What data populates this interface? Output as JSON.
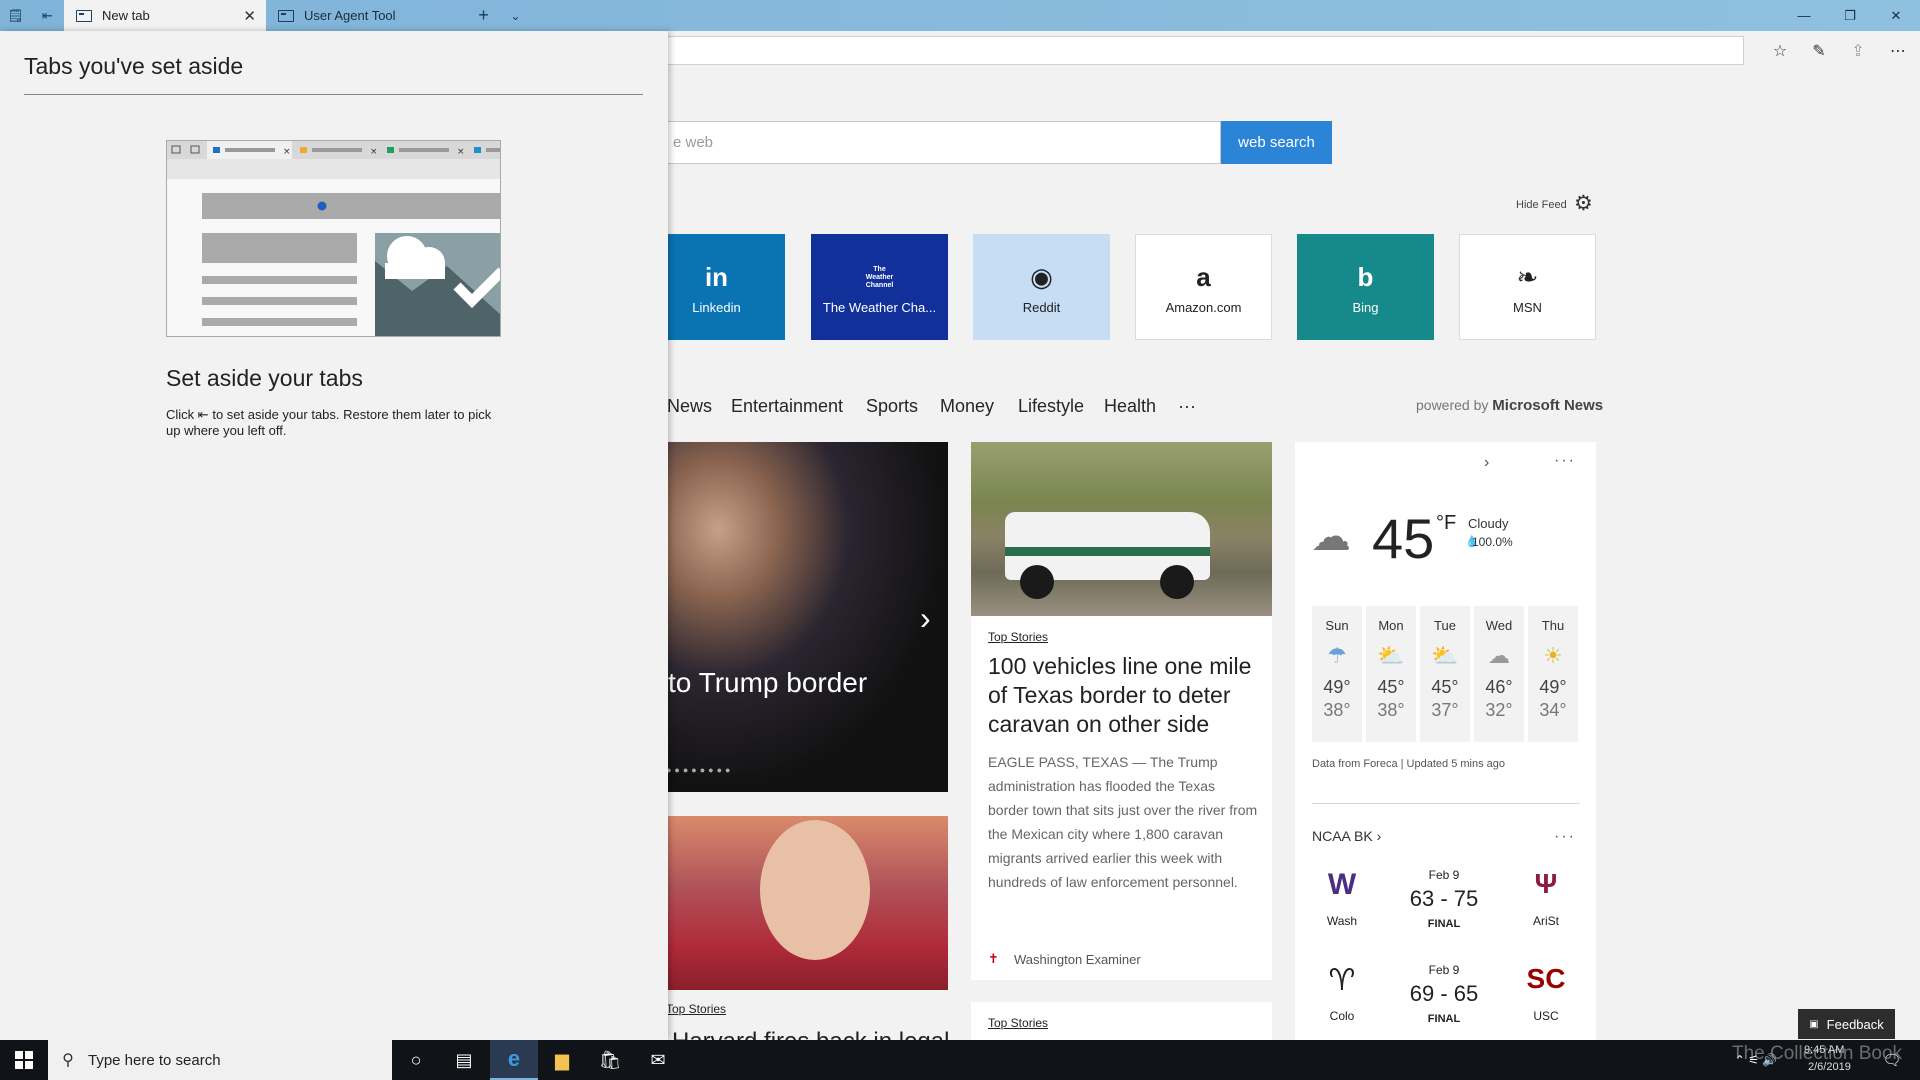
{
  "tabs": [
    {
      "label": "New tab"
    },
    {
      "label": "User Agent Tool"
    }
  ],
  "newtab": {
    "search_placeholder": "e web",
    "search_button": "web search",
    "hide_feed": "Hide Feed"
  },
  "tiles": [
    {
      "label": "Linkedin",
      "glyph": "in",
      "bg": "#0a73b1",
      "fg": "#ffffff"
    },
    {
      "label": "The Weather Cha...",
      "glyph": "The Weather Channel",
      "bg": "#12309a",
      "fg": "#ffffff"
    },
    {
      "label": "Reddit",
      "glyph": "◉",
      "bg": "#c6ddf4",
      "fg": "#222222"
    },
    {
      "label": "Amazon.com",
      "glyph": "a",
      "bg": "#ffffff",
      "fg": "#222222"
    },
    {
      "label": "Bing",
      "glyph": "b",
      "bg": "#168a8a",
      "fg": "#ffffff"
    },
    {
      "label": "MSN",
      "glyph": "❧",
      "bg": "#ffffff",
      "fg": "#222222"
    }
  ],
  "news_nav": [
    "News",
    "Entertainment",
    "Sports",
    "Money",
    "Lifestyle",
    "Health",
    "···"
  ],
  "powered_prefix": "powered by",
  "powered_brand": "Microsoft News",
  "hero": {
    "title": "to Trump border",
    "dots": "●●●●●●●●"
  },
  "card2": {
    "tag": "Top Stories",
    "title": "Harvard fires back in legal"
  },
  "card_mid": {
    "tag": "Top Stories",
    "title": "100 vehicles line one mile of Texas border to deter caravan on other side",
    "body": "EAGLE PASS, TEXAS — The Trump administration has flooded the Texas border town that sits just over the river from the Mexican city where 1,800 caravan migrants arrived earlier this week with hundreds of law enforcement personnel.",
    "source": "Washington Examiner"
  },
  "card_mid2": {
    "tag": "Top Stories"
  },
  "weather": {
    "temp": "45",
    "unit": "°F",
    "condition": "Cloudy",
    "precip": "100.0%",
    "days": [
      {
        "name": "Sun",
        "icon": "☂",
        "hi": "49°",
        "lo": "38°"
      },
      {
        "name": "Mon",
        "icon": "⛅",
        "hi": "45°",
        "lo": "38°"
      },
      {
        "name": "Tue",
        "icon": "⛅",
        "hi": "45°",
        "lo": "37°"
      },
      {
        "name": "Wed",
        "icon": "☁",
        "hi": "46°",
        "lo": "32°"
      },
      {
        "name": "Thu",
        "icon": "☀",
        "hi": "49°",
        "lo": "34°"
      }
    ],
    "source": "Data from Foreca | Updated 5 mins ago"
  },
  "ncaa": {
    "title": "NCAA BK",
    "games": [
      {
        "home": "Wash",
        "home_logo": "W",
        "away": "AriSt",
        "away_logo": "Ψ",
        "date": "Feb 9",
        "score": "63 - 75",
        "status": "FINAL"
      },
      {
        "home": "Colo",
        "home_logo": "♈",
        "away": "USC",
        "away_logo": "SC",
        "date": "Feb 9",
        "score": "69 - 65",
        "status": "FINAL"
      }
    ]
  },
  "feedback": "Feedback",
  "panel": {
    "title": "Tabs you've set aside",
    "heading": "Set aside your tabs",
    "desc_before": "Click",
    "desc_after": "to set aside your tabs. Restore them later to pick up where you left off."
  },
  "taskbar": {
    "search_text": "Type here to search",
    "time": "9:45 AM",
    "date": "2/6/2019"
  },
  "watermark": "The Collection Book",
  "colors": {
    "accent": "#2b84d6",
    "titlebar": "#8fc0e0",
    "taskbar": "#101418"
  }
}
